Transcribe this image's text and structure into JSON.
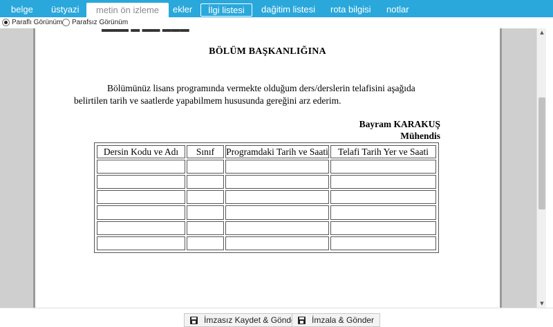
{
  "tabs": [
    {
      "label": "belge"
    },
    {
      "label": "üstyazi"
    },
    {
      "label": "metin ön izleme"
    },
    {
      "label": "ekler"
    },
    {
      "label": "İlgi listesi"
    },
    {
      "label": "dağitim listesi"
    },
    {
      "label": "rota bilgisi"
    },
    {
      "label": "notlar"
    }
  ],
  "view_options": {
    "with_initials": "Paraflı Görünüm",
    "without_initials": "Parafsız Görünüm"
  },
  "document": {
    "heading": "BÖLÜM BAŞKANLIĞINA",
    "paragraph": "Bölümünüz lisans programında vermekte olduğum  ders/derslerin telafisini aşağıda belirtilen tarih ve saatlerde yapabilmem  hususunda gereğini arz ederim.",
    "signer_name": "Bayram KARAKUŞ",
    "signer_title": "Mühendis",
    "table_headers": [
      "Dersin Kodu ve Adı",
      "Sınıf",
      "Programdaki Tarih ve Saati",
      "Telafi Tarih Yer ve Saati"
    ]
  },
  "buttons": {
    "save_unsigned": "İmzasız Kaydet & Gönder",
    "sign_send": "İmzala & Gönder"
  },
  "colors": {
    "tabbar": "#2aa8db",
    "viewer_bg": "#cfcfcf"
  }
}
